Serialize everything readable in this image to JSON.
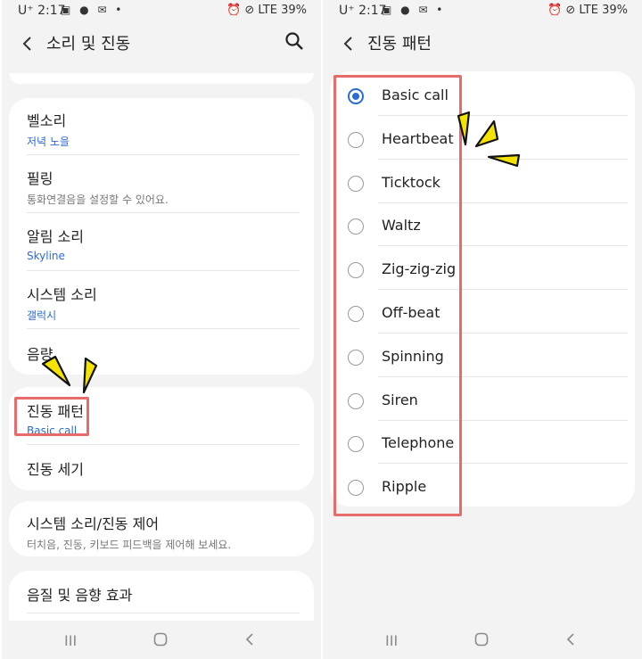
{
  "status": {
    "time": "2:17",
    "carrier": "U⁺",
    "notif_icons": "▣ ● ✉ •",
    "right_icons": "⏰ ⊘ LTE",
    "battery": "39%"
  },
  "left": {
    "title": "소리 및 진동",
    "items": [
      {
        "label": "벨소리",
        "sub": "저녁 노을"
      },
      {
        "label": "필링",
        "sub": "통화연결음을 설정할 수 있어요."
      },
      {
        "label": "알림 소리",
        "sub": "Skyline"
      },
      {
        "label": "시스템 소리",
        "sub": "갤럭시"
      },
      {
        "label": "음량"
      },
      {
        "label": "진동 패턴",
        "sub": "Basic call"
      },
      {
        "label": "진동 세기"
      },
      {
        "label": "시스템 소리/진동 제어",
        "sub": "터치음, 진동, 키보드 피드백을 제어해 보세요."
      },
      {
        "label": "음질 및 음향 효과"
      }
    ]
  },
  "right": {
    "title": "진동 패턴",
    "options": [
      {
        "label": "Basic call",
        "selected": true
      },
      {
        "label": "Heartbeat",
        "selected": false
      },
      {
        "label": "Ticktock",
        "selected": false
      },
      {
        "label": "Waltz",
        "selected": false
      },
      {
        "label": "Zig-zig-zig",
        "selected": false
      },
      {
        "label": "Off-beat",
        "selected": false
      },
      {
        "label": "Spinning",
        "selected": false
      },
      {
        "label": "Siren",
        "selected": false
      },
      {
        "label": "Telephone",
        "selected": false
      },
      {
        "label": "Ripple",
        "selected": false
      }
    ]
  },
  "nav": {
    "recent": "III",
    "home": "◯",
    "back": "<"
  },
  "colors": {
    "accent": "#2a6bd6",
    "highlight": "#e86b6b",
    "sparkle": "#f4e300"
  }
}
